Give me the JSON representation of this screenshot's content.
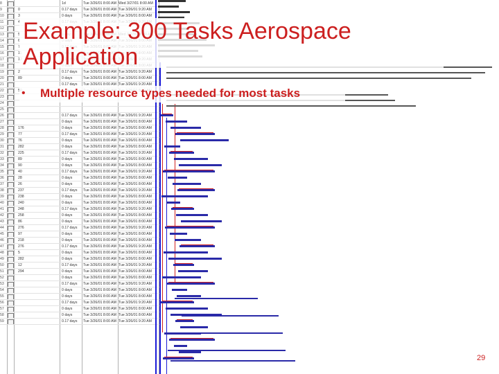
{
  "slide": {
    "title": "Example: 300 Tasks Aerospace Application",
    "bullets": [
      "Multiple resource types needed for most tasks"
    ],
    "page_number": "29"
  },
  "gantt": {
    "colors": {
      "bar": "#2a2aa8",
      "spine": "#1a1ad6",
      "critical": "#d02020",
      "grid": "#b0b0b0"
    },
    "rows": [
      {
        "n": "8",
        "id": "",
        "dur": "1d",
        "start": "Tue 3/26/01 8:00 AM",
        "finish": "Wed 3/27/01 8:00 AM"
      },
      {
        "n": "9",
        "id": "0",
        "dur": "0.17 days",
        "start": "Tue 3/26/01 8:00 AM",
        "finish": "Tue 3/26/01 9:20 AM"
      },
      {
        "n": "10",
        "id": "3",
        "dur": "0 days",
        "start": "Tue 3/26/01 8:00 AM",
        "finish": "Tue 3/26/01 8:00 AM"
      },
      {
        "n": "11",
        "id": "4",
        "dur": "0.17 days",
        "start": "Tue 3/26/01 8:00 AM",
        "finish": "Tue 3/26/01 9:20 AM"
      },
      {
        "n": "12",
        "id": "",
        "dur": "",
        "start": "",
        "finish": ""
      },
      {
        "n": "13",
        "id": "5",
        "dur": "1 day",
        "start": "Tue 3/26/01 8:00 AM",
        "finish": "Wed 3/27/01 8:00 AM"
      },
      {
        "n": "14",
        "id": "6",
        "dur": "0 days",
        "start": "Tue 3/26/01 8:00 AM",
        "finish": "Tue 3/26/01 8:00 AM"
      },
      {
        "n": "15",
        "id": "7",
        "dur": "0.17 days",
        "start": "Tue 3/26/01 8:00 AM",
        "finish": "Tue 3/26/01 9:20 AM"
      },
      {
        "n": "16",
        "id": "11",
        "dur": "0 days",
        "start": "Tue 3/26/01 8:00 AM",
        "finish": "Tue 3/26/01 8:00 AM"
      },
      {
        "n": "17",
        "id": "12",
        "dur": "0.17 days",
        "start": "Tue 3/26/01 8:00 AM",
        "finish": "Tue 3/26/01 9:20 AM"
      },
      {
        "n": "18",
        "id": "",
        "dur": "0 days",
        "start": "Tue 3/26/01 8:00 AM",
        "finish": "Tue 3/26/01 8:00 AM"
      },
      {
        "n": "19",
        "id": "2",
        "dur": "0.17 days",
        "start": "Tue 3/26/01 8:00 AM",
        "finish": "Tue 3/26/01 9:20 AM"
      },
      {
        "n": "20",
        "id": "89",
        "dur": "0 days",
        "start": "Tue 3/26/01 8:00 AM",
        "finish": "Tue 3/26/01 8:00 AM"
      },
      {
        "n": "21",
        "id": "",
        "dur": "0.17 days",
        "start": "Tue 3/26/01 8:00 AM",
        "finish": "Tue 3/26/01 9:20 AM"
      },
      {
        "n": "22",
        "id": "50",
        "dur": "0 days",
        "start": "Tue 3/26/01 8:00 AM",
        "finish": "Tue 3/26/01 8:00 AM"
      },
      {
        "n": "23",
        "id": "",
        "dur": "",
        "start": "",
        "finish": ""
      },
      {
        "n": "24",
        "id": "",
        "dur": "",
        "start": "",
        "finish": ""
      },
      {
        "n": "25",
        "id": "",
        "dur": "",
        "start": "",
        "finish": ""
      },
      {
        "n": "26",
        "id": "",
        "dur": "0.17 days",
        "start": "Tue 3/26/01 8:00 AM",
        "finish": "Tue 3/26/01 9:20 AM"
      },
      {
        "n": "27",
        "id": "",
        "dur": "0 days",
        "start": "Tue 3/26/01 8:00 AM",
        "finish": "Tue 3/26/01 8:00 AM"
      },
      {
        "n": "28",
        "id": "176",
        "dur": "0 days",
        "start": "Tue 3/26/01 8:00 AM",
        "finish": "Tue 3/26/01 8:00 AM"
      },
      {
        "n": "29",
        "id": "77",
        "dur": "0.17 days",
        "start": "Tue 3/26/01 8:00 AM",
        "finish": "Tue 3/26/01 9:20 AM"
      },
      {
        "n": "30",
        "id": "76",
        "dur": "0 days",
        "start": "Tue 3/26/01 8:00 AM",
        "finish": "Tue 3/26/01 8:00 AM"
      },
      {
        "n": "31",
        "id": "282",
        "dur": "0 days",
        "start": "Tue 3/26/01 8:00 AM",
        "finish": "Tue 3/26/01 8:00 AM"
      },
      {
        "n": "32",
        "id": "225",
        "dur": "0.17 days",
        "start": "Tue 3/26/01 8:00 AM",
        "finish": "Tue 3/26/01 9:20 AM"
      },
      {
        "n": "33",
        "id": "89",
        "dur": "0 days",
        "start": "Tue 3/26/01 8:00 AM",
        "finish": "Tue 3/26/01 8:00 AM"
      },
      {
        "n": "34",
        "id": "90",
        "dur": "0 days",
        "start": "Tue 3/26/01 8:00 AM",
        "finish": "Tue 3/26/01 8:00 AM"
      },
      {
        "n": "35",
        "id": "40",
        "dur": "0.17 days",
        "start": "Tue 3/26/01 8:00 AM",
        "finish": "Tue 3/26/01 9:20 AM"
      },
      {
        "n": "36",
        "id": "28",
        "dur": "0 days",
        "start": "Tue 3/26/01 8:00 AM",
        "finish": "Tue 3/26/01 8:00 AM"
      },
      {
        "n": "37",
        "id": "26",
        "dur": "0 days",
        "start": "Tue 3/26/01 8:00 AM",
        "finish": "Tue 3/26/01 8:00 AM"
      },
      {
        "n": "38",
        "id": "237",
        "dur": "0.17 days",
        "start": "Tue 3/26/01 8:00 AM",
        "finish": "Tue 3/26/01 9:20 AM"
      },
      {
        "n": "39",
        "id": "238",
        "dur": "0 days",
        "start": "Tue 3/26/01 8:00 AM",
        "finish": "Tue 3/26/01 8:00 AM"
      },
      {
        "n": "40",
        "id": "240",
        "dur": "0 days",
        "start": "Tue 3/26/01 8:00 AM",
        "finish": "Tue 3/26/01 8:00 AM"
      },
      {
        "n": "41",
        "id": "248",
        "dur": "0.17 days",
        "start": "Tue 3/26/01 8:00 AM",
        "finish": "Tue 3/26/01 9:20 AM"
      },
      {
        "n": "42",
        "id": "258",
        "dur": "0 days",
        "start": "Tue 3/26/01 8:00 AM",
        "finish": "Tue 3/26/01 8:00 AM"
      },
      {
        "n": "43",
        "id": "86",
        "dur": "0 days",
        "start": "Tue 3/26/01 8:00 AM",
        "finish": "Tue 3/26/01 8:00 AM"
      },
      {
        "n": "44",
        "id": "276",
        "dur": "0.17 days",
        "start": "Tue 3/26/01 8:00 AM",
        "finish": "Tue 3/26/01 9:20 AM"
      },
      {
        "n": "45",
        "id": "97",
        "dur": "0 days",
        "start": "Tue 3/26/01 8:00 AM",
        "finish": "Tue 3/26/01 8:00 AM"
      },
      {
        "n": "46",
        "id": "218",
        "dur": "0 days",
        "start": "Tue 3/26/01 8:00 AM",
        "finish": "Tue 3/26/01 8:00 AM"
      },
      {
        "n": "47",
        "id": "276",
        "dur": "0.17 days",
        "start": "Tue 3/26/01 8:00 AM",
        "finish": "Tue 3/26/01 9:20 AM"
      },
      {
        "n": "48",
        "id": "5",
        "dur": "0 days",
        "start": "Tue 3/26/01 8:00 AM",
        "finish": "Tue 3/26/01 8:00 AM"
      },
      {
        "n": "49",
        "id": "282",
        "dur": "0 days",
        "start": "Tue 3/26/01 8:00 AM",
        "finish": "Tue 3/26/01 8:00 AM"
      },
      {
        "n": "50",
        "id": "12",
        "dur": "0.17 days",
        "start": "Tue 3/26/01 8:00 AM",
        "finish": "Tue 3/26/01 9:20 AM"
      },
      {
        "n": "51",
        "id": "294",
        "dur": "0 days",
        "start": "Tue 3/26/01 8:00 AM",
        "finish": "Tue 3/26/01 8:00 AM"
      },
      {
        "n": "52",
        "id": "",
        "dur": "0 days",
        "start": "Tue 3/26/01 8:00 AM",
        "finish": "Tue 3/26/01 8:00 AM"
      },
      {
        "n": "53",
        "id": "",
        "dur": "0.17 days",
        "start": "Tue 3/26/01 8:00 AM",
        "finish": "Tue 3/26/01 9:20 AM"
      },
      {
        "n": "54",
        "id": "",
        "dur": "0 days",
        "start": "Tue 3/26/01 8:00 AM",
        "finish": "Tue 3/26/01 8:00 AM"
      },
      {
        "n": "55",
        "id": "",
        "dur": "0 days",
        "start": "Tue 3/26/01 8:00 AM",
        "finish": "Tue 3/26/01 8:00 AM"
      },
      {
        "n": "56",
        "id": "",
        "dur": "0.17 days",
        "start": "Tue 3/26/01 8:00 AM",
        "finish": "Tue 3/26/01 9:20 AM"
      },
      {
        "n": "57",
        "id": "",
        "dur": "0 days",
        "start": "Tue 3/26/01 8:00 AM",
        "finish": "Tue 3/26/01 8:00 AM"
      },
      {
        "n": "58",
        "id": "",
        "dur": "0 days",
        "start": "Tue 3/26/01 8:00 AM",
        "finish": "Tue 3/26/01 8:00 AM"
      },
      {
        "n": "59",
        "id": "",
        "dur": "0.17 days",
        "start": "Tue 3/26/01 8:00 AM",
        "finish": "Tue 3/26/01 9:20 AM"
      }
    ]
  }
}
